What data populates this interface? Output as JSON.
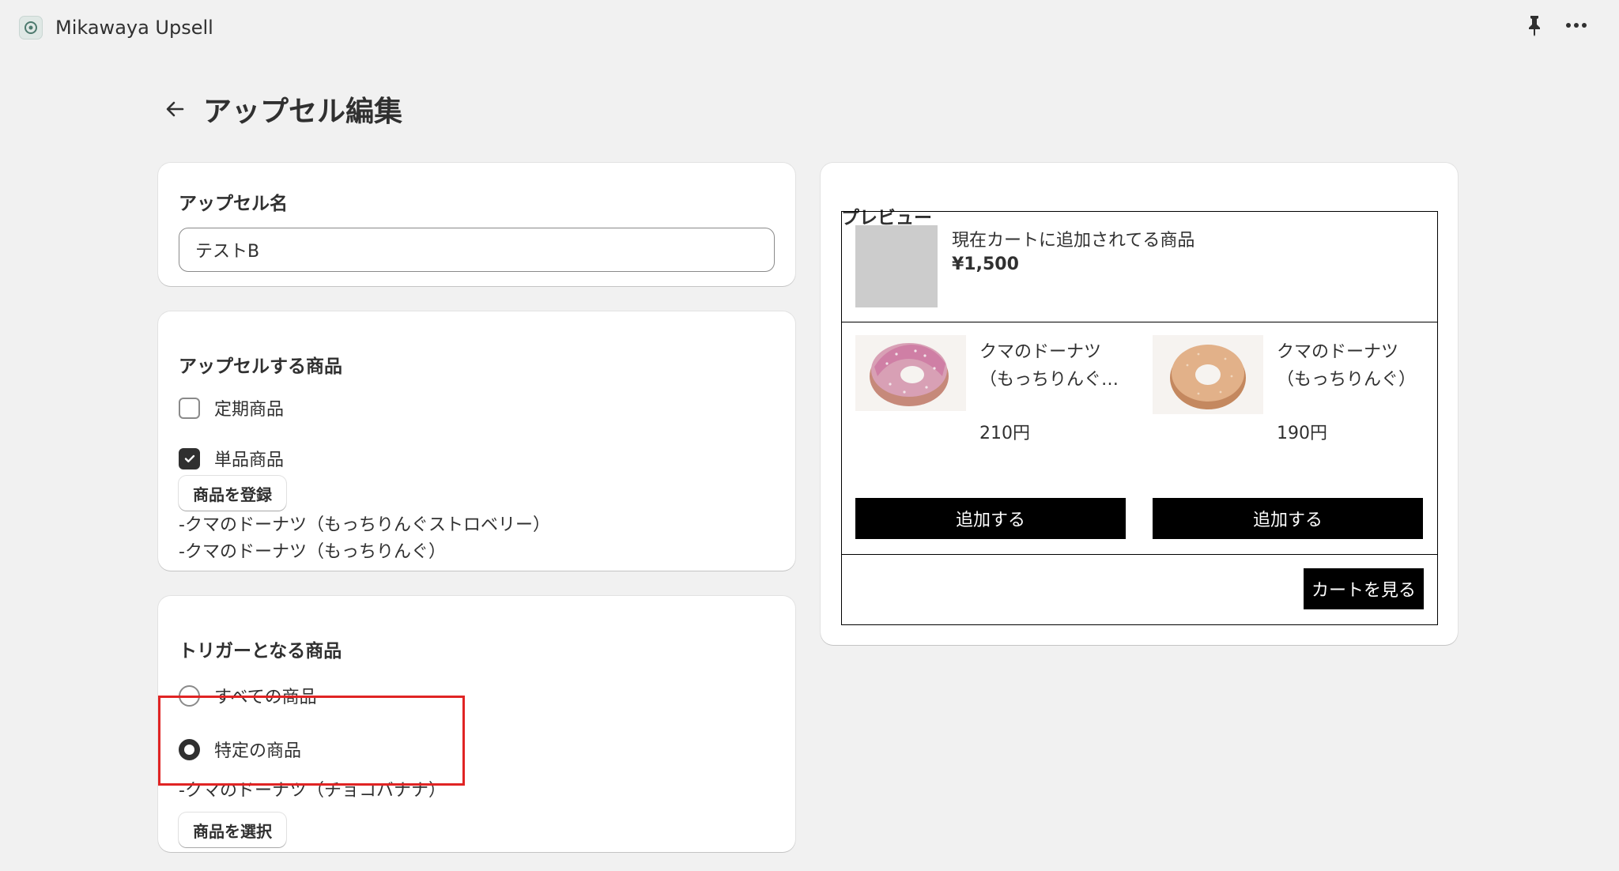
{
  "app": {
    "title": "Mikawaya Upsell",
    "logo_icon": "app-logo-icon"
  },
  "header": {
    "title": "アップセル編集",
    "back_icon": "arrow-left-icon"
  },
  "name_card": {
    "title": "アップセル名",
    "input_value": "テストB"
  },
  "upsell_products": {
    "title": "アップセルする商品",
    "options": [
      {
        "label": "定期商品",
        "checked": false
      },
      {
        "label": "単品商品",
        "checked": true
      }
    ],
    "register_button": "商品を登録",
    "items": [
      "-クマのドーナツ（もっちりんぐストロベリー）",
      "-クマのドーナツ（もっちりんぐ）"
    ]
  },
  "trigger": {
    "title": "トリガーとなる商品",
    "options": [
      {
        "label": "すべての商品",
        "selected": false
      },
      {
        "label": "特定の商品",
        "selected": true
      }
    ],
    "selected_item": "-クマのドーナツ（チョコバナナ）",
    "select_button": "商品を選択"
  },
  "preview": {
    "title": "プレビュー",
    "current_item": {
      "name": "現在カートに追加されてる商品",
      "price": "¥1,500"
    },
    "products": [
      {
        "name_line1": "クマのドーナツ",
        "name_line2": "（もっちりんぐ…",
        "price": "210円",
        "add_label": "追加する",
        "image": "pink-donut"
      },
      {
        "name_line1": "クマのドーナツ",
        "name_line2": "（もっちりんぐ）",
        "price": "190円",
        "add_label": "追加する",
        "image": "plain-donut"
      }
    ],
    "view_cart_label": "カートを見る"
  },
  "colors": {
    "accent": "#303030",
    "highlight": "#e02424",
    "preview_button": "#000000"
  }
}
